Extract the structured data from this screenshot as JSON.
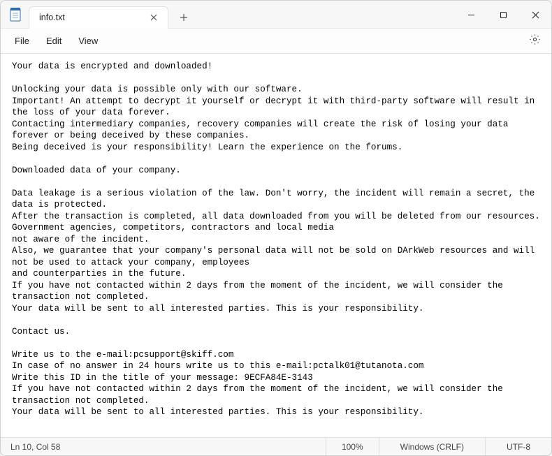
{
  "tab": {
    "title": "info.txt"
  },
  "menu": {
    "file": "File",
    "edit": "Edit",
    "view": "View"
  },
  "content": "Your data is encrypted and downloaded!\n\nUnlocking your data is possible only with our software.\nImportant! An attempt to decrypt it yourself or decrypt it with third-party software will result in the loss of your data forever.\nContacting intermediary companies, recovery companies will create the risk of losing your data forever or being deceived by these companies.\nBeing deceived is your responsibility! Learn the experience on the forums.\n\nDownloaded data of your company.\n\nData leakage is a serious violation of the law. Don't worry, the incident will remain a secret, the data is protected.\nAfter the transaction is completed, all data downloaded from you will be deleted from our resources. Government agencies, competitors, contractors and local media\nnot aware of the incident.\nAlso, we guarantee that your company's personal data will not be sold on DArkWeb resources and will not be used to attack your company, employees\nand counterparties in the future.\nIf you have not contacted within 2 days from the moment of the incident, we will consider the transaction not completed.\nYour data will be sent to all interested parties. This is your responsibility.\n\nContact us.\n\nWrite us to the e-mail:pcsupport@skiff.com\nIn case of no answer in 24 hours write us to this e-mail:pctalk01@tutanota.com\nWrite this ID in the title of your message: 9ECFA84E-3143\nIf you have not contacted within 2 days from the moment of the incident, we will consider the transaction not completed.\nYour data will be sent to all interested parties. This is your responsibility.",
  "status": {
    "cursor": "Ln 10, Col 58",
    "zoom": "100%",
    "lineending": "Windows (CRLF)",
    "encoding": "UTF-8"
  }
}
